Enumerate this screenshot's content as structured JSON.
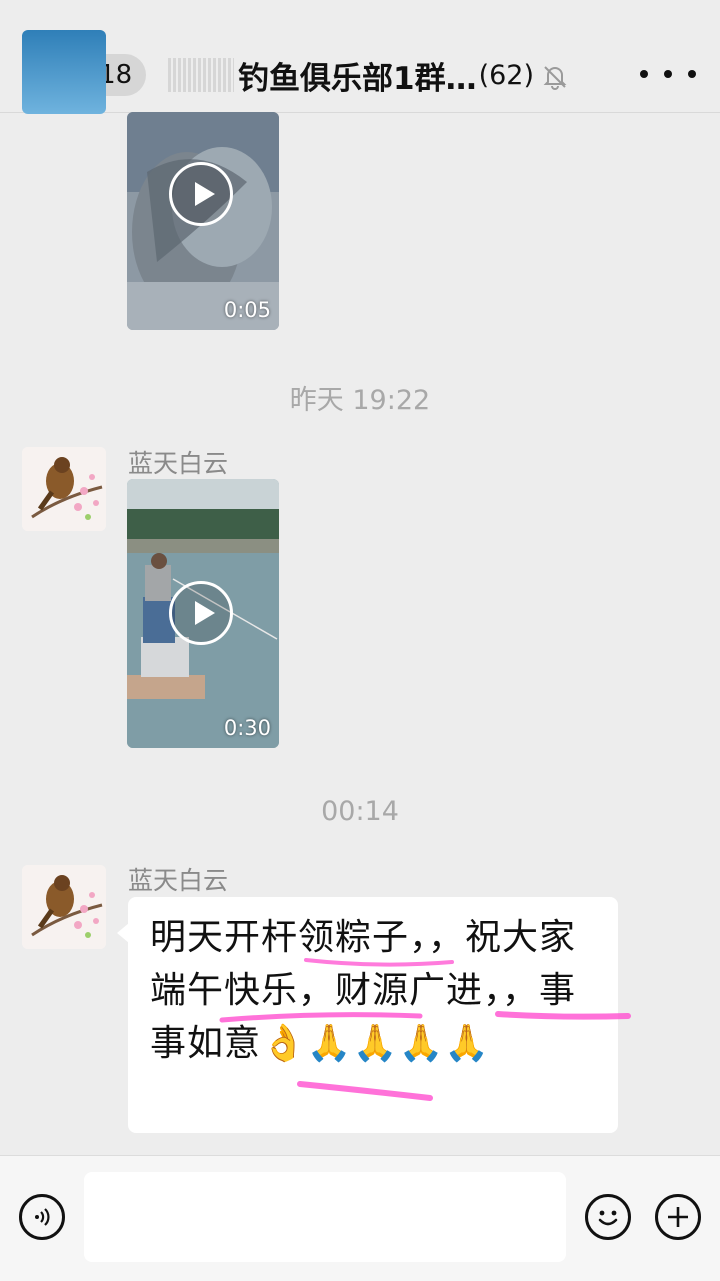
{
  "header": {
    "back_count": "1118",
    "title": "钓鱼俱乐部1群…",
    "member_count": "(62)"
  },
  "messages": [
    {
      "type": "video",
      "duration": "0:05"
    },
    {
      "type": "timestamp",
      "text": "昨天 19:22"
    },
    {
      "type": "video",
      "sender": "蓝天白云",
      "duration": "0:30"
    },
    {
      "type": "timestamp",
      "text": "00:14"
    },
    {
      "type": "text",
      "sender": "蓝天白云",
      "text": "明天开杆领粽子，，祝大家端午快乐，财源广进，，事事如意👌🙏🙏🙏🙏"
    }
  ],
  "input": {
    "value": "",
    "placeholder": ""
  },
  "icons": [
    "back-chevron-icon",
    "mute-icon",
    "more-icon",
    "voice-icon",
    "emoji-icon",
    "plus-icon",
    "play-icon"
  ],
  "colors": {
    "background": "#ededed",
    "bubble": "#ffffff",
    "highlight": "#ff4fd0"
  }
}
